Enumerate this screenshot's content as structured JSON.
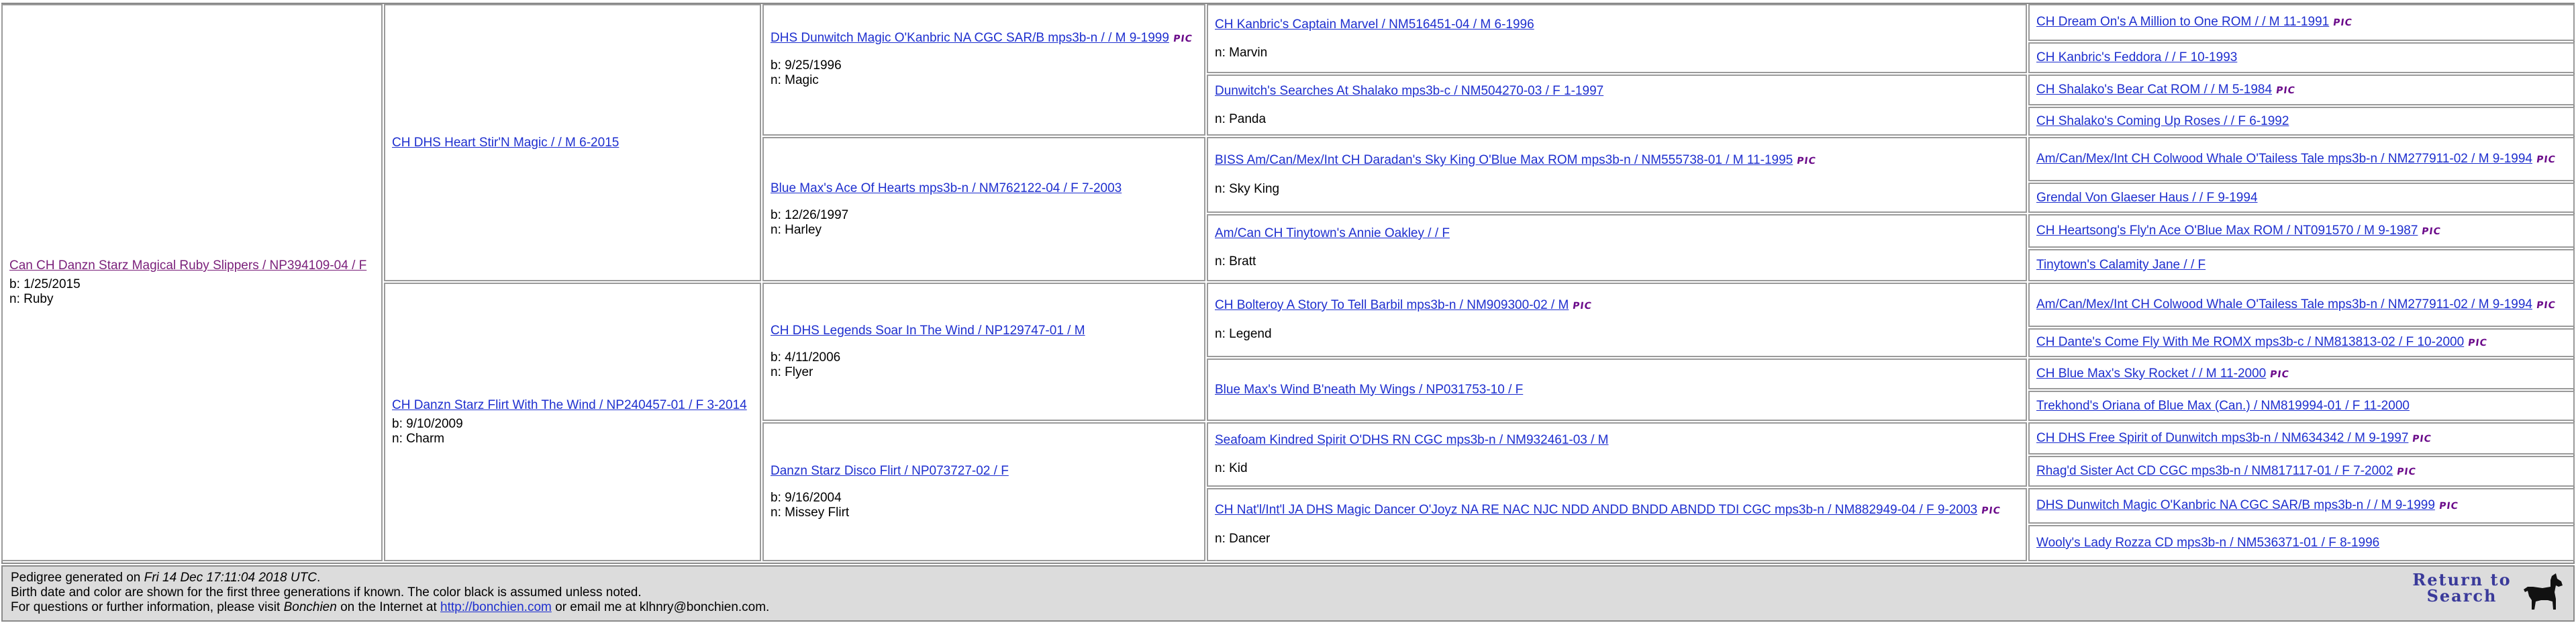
{
  "subject": {
    "name": "Can CH Danzn Starz Magical Ruby Slippers / NP394109-04 / F",
    "birth": "b: 1/25/2015",
    "nick": "n: Ruby"
  },
  "gen2": [
    {
      "name": "CH DHS Heart Stir'N Magic / / M 6-2015"
    },
    {
      "name": "CH Danzn Starz Flirt With The Wind / NP240457-01 / F 3-2014",
      "birth": "b: 9/10/2009",
      "nick": "n: Charm"
    }
  ],
  "gen3": [
    {
      "name": "DHS Dunwitch Magic O'Kanbric NA CGC SAR/B mps3b-n / / M 9-1999",
      "birth": "b: 9/25/1996",
      "nick": "n: Magic"
    },
    {
      "name": "Blue Max's Ace Of Hearts mps3b-n / NM762122-04 / F 7-2003",
      "birth": "b: 12/26/1997",
      "nick": "n: Harley"
    },
    {
      "name": "CH DHS Legends Soar In The Wind / NP129747-01 / M",
      "birth": "b: 4/11/2006",
      "nick": "n: Flyer"
    },
    {
      "name": "Danzn Starz Disco Flirt / NP073727-02 / F",
      "birth": "b: 9/16/2004",
      "nick": "n: Missey Flirt"
    }
  ],
  "gen4": [
    {
      "name": "CH Kanbric's Captain Marvel / NM516451-04 / M 6-1996",
      "nick": "n: Marvin"
    },
    {
      "name": "Dunwitch's Searches At Shalako mps3b-c / NM504270-03 / F 1-1997",
      "nick": "n: Panda"
    },
    {
      "name": "BISS Am/Can/Mex/Int CH Daradan's Sky King O'Blue Max ROM mps3b-n / NM555738-01 / M 11-1995",
      "nick": "n: Sky King"
    },
    {
      "name": "Am/Can CH Tinytown's Annie Oakley / / F",
      "nick": "n: Bratt"
    },
    {
      "name": "CH Bolteroy A Story To Tell Barbil mps3b-n / NM909300-02 / M",
      "nick": "n: Legend"
    },
    {
      "name": "Blue Max's Wind B'neath My Wings / NP031753-10 / F",
      "nick": ""
    },
    {
      "name": "Seafoam Kindred Spirit O'DHS RN CGC mps3b-n / NM932461-03 / M",
      "nick": "n: Kid"
    },
    {
      "name": "CH Nat'l/Int'l JA DHS Magic Dancer O'Joyz NA RE NAC NJC NDD ANDD BNDD ABNDD TDI CGC mps3b-n / NM882949-04 / F 9-2003",
      "nick": "n: Dancer"
    }
  ],
  "gen5": [
    {
      "name": "CH Dream On's A Million to One ROM / / M 11-1991"
    },
    {
      "name": "CH Kanbric's Feddora / / F 10-1993"
    },
    {
      "name": "CH Shalako's Bear Cat ROM / / M 5-1984"
    },
    {
      "name": "CH Shalako's Coming Up Roses / / F 6-1992"
    },
    {
      "name": "Am/Can/Mex/Int CH Colwood Whale O'Tailess Tale mps3b-n / NM277911-02 / M 9-1994"
    },
    {
      "name": "Grendal Von Glaeser Haus / / F 9-1994"
    },
    {
      "name": "CH Heartsong's Fly'n Ace O'Blue Max ROM / NT091570 / M 9-1987"
    },
    {
      "name": "Tinytown's Calamity Jane / / F"
    },
    {
      "name": "Am/Can/Mex/Int CH Colwood Whale O'Tailess Tale mps3b-n / NM277911-02 / M 9-1994"
    },
    {
      "name": "CH Dante's Come Fly With Me ROMX mps3b-c / NM813813-02 / F 10-2000"
    },
    {
      "name": "CH Blue Max's Sky Rocket / / M 11-2000"
    },
    {
      "name": "Trekhond's Oriana of Blue Max (Can.) / NM819994-01 / F 11-2000"
    },
    {
      "name": "CH DHS Free Spirit of Dunwitch mps3b-n / NM634342 / M 9-1997"
    },
    {
      "name": "Rhag'd Sister Act CD CGC mps3b-n / NM817117-01 / F 7-2002"
    },
    {
      "name": "DHS Dunwitch Magic O'Kanbric NA CGC SAR/B mps3b-n / / M 9-1999"
    },
    {
      "name": "Wooly's Lady Rozza CD mps3b-n / NM536371-01 / F 8-1996"
    }
  ],
  "pic_label": "PIC",
  "footer": {
    "line1_prefix": "Pedigree generated on ",
    "line1_date": "Fri 14 Dec 17:11:04 2018 UTC",
    "line1_suffix": ".",
    "line2": "Birth date and color are shown for the first three generations if known. The color black is assumed unless noted.",
    "line3_prefix": "For questions or further information, please visit ",
    "line3_brand": "Bonchien",
    "line3_mid": " on the Internet at ",
    "line3_link": "http://bonchien.com",
    "line3_suffix": " or email me at klhnry@bonchien.com."
  },
  "return_button": {
    "line1": "Return to",
    "line2": "Search"
  }
}
